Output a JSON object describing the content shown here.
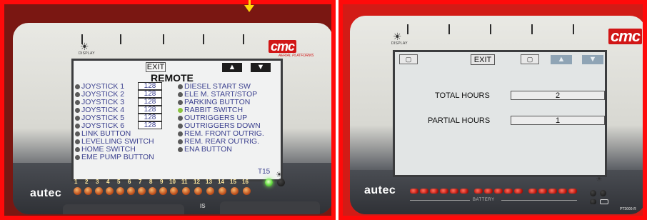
{
  "left_panel": {
    "display_label": "DISPLAY",
    "logo": "cmc",
    "logo_sub": "AERIAL PLATFORMS",
    "screen": {
      "exit_label": "EXIT",
      "up_arrow": "▲",
      "down_arrow": "▼",
      "title": "REMOTE",
      "joysticks": [
        {
          "label": "JOYSTICK 1",
          "value": "128"
        },
        {
          "label": "JOYSTICK 2",
          "value": "128"
        },
        {
          "label": "JOYSTICK 3",
          "value": "128"
        },
        {
          "label": "JOYSTICK 4",
          "value": "128"
        },
        {
          "label": "JOYSTICK 5",
          "value": "128"
        },
        {
          "label": "JOYSTICK 6",
          "value": "128"
        }
      ],
      "left_buttons": [
        "LINK BUTTON",
        "LEVELLING SWITCH",
        "HOME SWITCH",
        "EME PUMP BUTTON"
      ],
      "right_items": [
        {
          "label": "DIESEL START SW",
          "state": "off"
        },
        {
          "label": "ELE M. START/STOP",
          "state": "off"
        },
        {
          "label": "PARKING BUTTON",
          "state": "off"
        },
        {
          "label": "RABBIT SWITCH",
          "state": "on"
        },
        {
          "label": "OUTRIGGERS UP",
          "state": "off"
        },
        {
          "label": "OUTRIGGERS DOWN",
          "state": "off"
        },
        {
          "label": "REM. FRONT OUTRIG.",
          "state": "off"
        },
        {
          "label": "REM. REAR OUTRIG.",
          "state": "off"
        },
        {
          "label": "ENA BUTTON",
          "state": "off"
        }
      ],
      "code": "T15"
    },
    "brand": "autec",
    "numbers": [
      "1",
      "2",
      "3",
      "4",
      "5",
      "6",
      "7",
      "8",
      "9",
      "10",
      "11",
      "12",
      "13",
      "14",
      "15",
      "16"
    ],
    "bottom_fragment": "IS",
    "status_icons": "☀"
  },
  "right_panel": {
    "display_label": "DISPLAY",
    "logo": "cmc",
    "screen": {
      "exit_label": "EXIT",
      "up_arrow": "▲",
      "down_arrow": "▼",
      "total_hours_label": "TOTAL HOURS",
      "total_hours_value": "2",
      "partial_hours_label": "PARTIAL HOURS",
      "partial_hours_value": "1"
    },
    "brand": "autec",
    "battery_label": "BATTERY",
    "model_code": "PT3000-R",
    "status_icons": "☀"
  },
  "colors": {
    "frame_red": "#ff0a0a",
    "logo_red": "#d11616",
    "indicator_green": "#8bc43f",
    "pointer_yellow": "#ffd60a"
  }
}
